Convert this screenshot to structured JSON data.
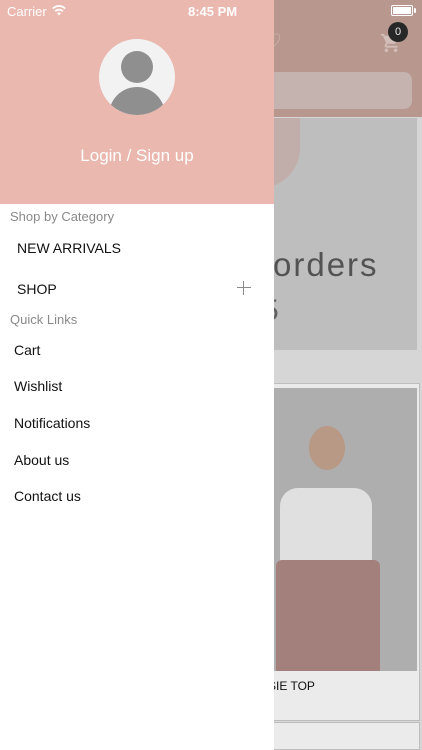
{
  "status_bar": {
    "carrier": "Carrier",
    "time": "8:45 PM"
  },
  "background": {
    "cart_count": "0",
    "banner_text": "orders",
    "banner_subtext": "5",
    "product_title": "SIE TOP"
  },
  "drawer": {
    "login_label": "Login / Sign up",
    "shop_by_category_title": "Shop by Category",
    "categories": [
      {
        "label": "NEW ARRIVALS"
      },
      {
        "label": "SHOP"
      }
    ],
    "quick_links_title": "Quick Links",
    "quick_links": [
      {
        "label": "Cart"
      },
      {
        "label": "Wishlist"
      },
      {
        "label": "Notifications"
      },
      {
        "label": "About us"
      },
      {
        "label": "Contact us"
      }
    ]
  },
  "colors": {
    "drawer_header": "#eab8ae",
    "app_header": "#c7a49b"
  }
}
